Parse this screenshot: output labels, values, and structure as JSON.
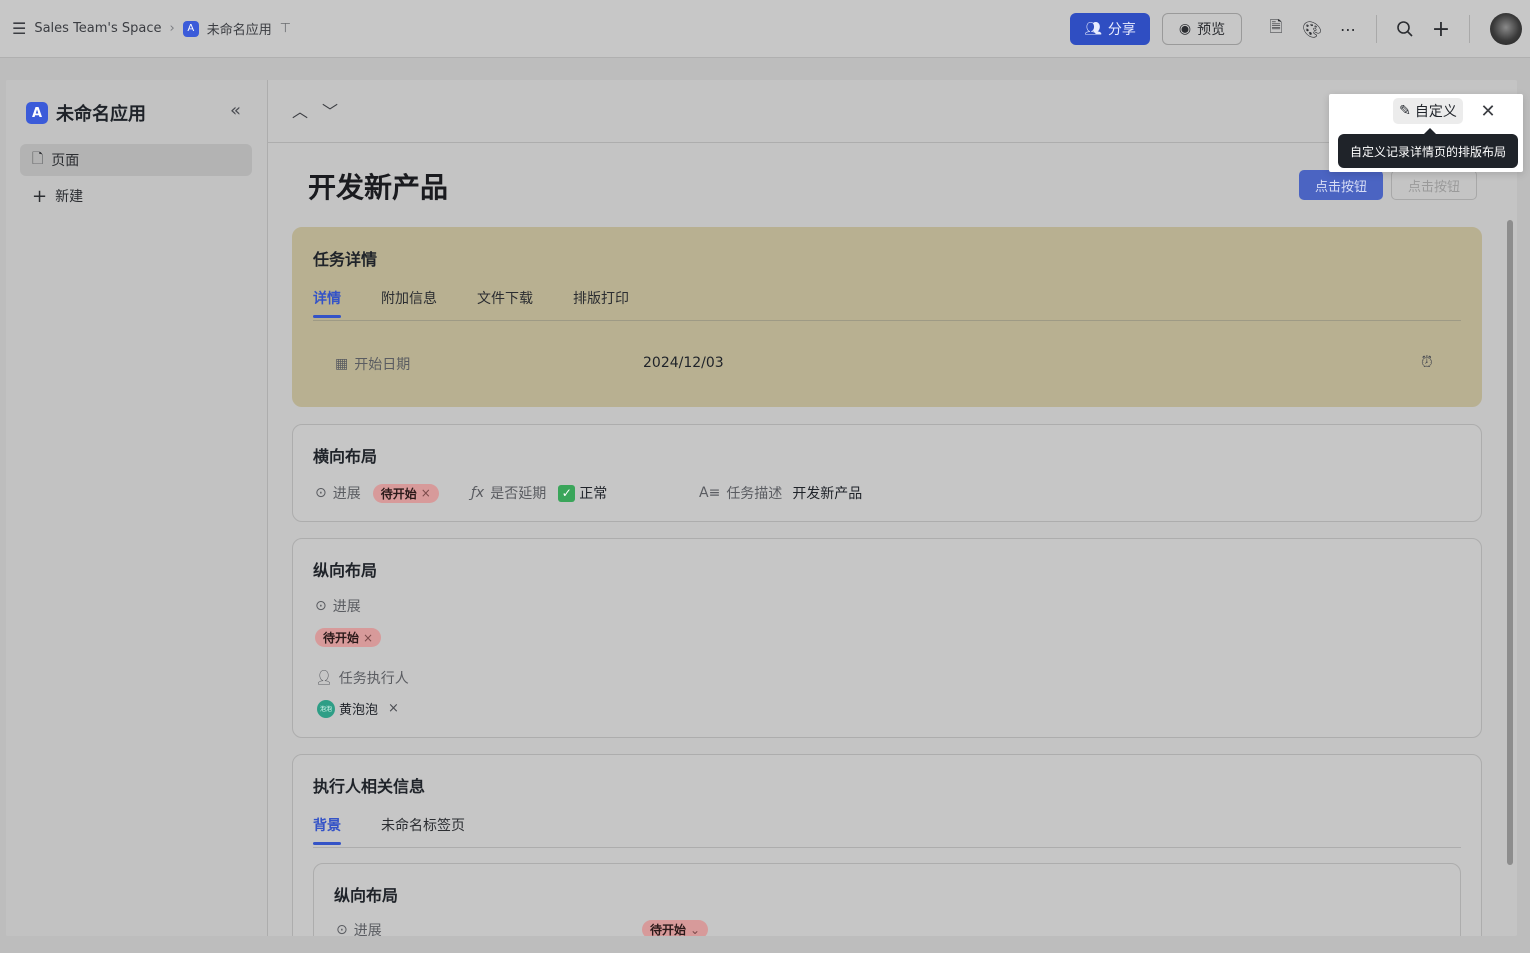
{
  "topbar": {
    "space_name": "Sales Team's Space",
    "breadcrumb_sep": "›",
    "app_name": "未命名应用",
    "share_label": "分享",
    "preview_label": "预览"
  },
  "sidebar": {
    "app_title": "未命名应用",
    "items": [
      {
        "label": "页面"
      },
      {
        "label": "新建"
      }
    ]
  },
  "record": {
    "title": "开发新产品",
    "button_primary": "点击按钮",
    "button_secondary": "点击按钮"
  },
  "task_card": {
    "title": "任务详情",
    "tabs": [
      "详情",
      "附加信息",
      "文件下载",
      "排版打印"
    ],
    "start_date_label": "开始日期",
    "start_date_value": "2024/12/03"
  },
  "horizontal_card": {
    "title": "横向布局",
    "progress_label": "进展",
    "progress_value": "待开始",
    "delay_label": "是否延期",
    "delay_value": "正常",
    "desc_label": "任务描述",
    "desc_value": "开发新产品"
  },
  "vertical_card": {
    "title": "纵向布局",
    "progress_label": "进展",
    "progress_value": "待开始",
    "assignee_label": "任务执行人",
    "assignee_value": "黄泡泡",
    "assignee_avatar_text": "泡泡"
  },
  "executor_card": {
    "title": "执行人相关信息",
    "tabs": [
      "背景",
      "未命名标签页"
    ],
    "inner_title": "纵向布局",
    "inner_progress_label": "进展",
    "inner_progress_value": "待开始"
  },
  "popover": {
    "customize_label": "自定义",
    "tooltip": "自定义记录详情页的排版布局"
  },
  "colors": {
    "accent": "#3453c7",
    "tag_bg": "#d79a9a",
    "card_highlight": "#b8b091"
  }
}
